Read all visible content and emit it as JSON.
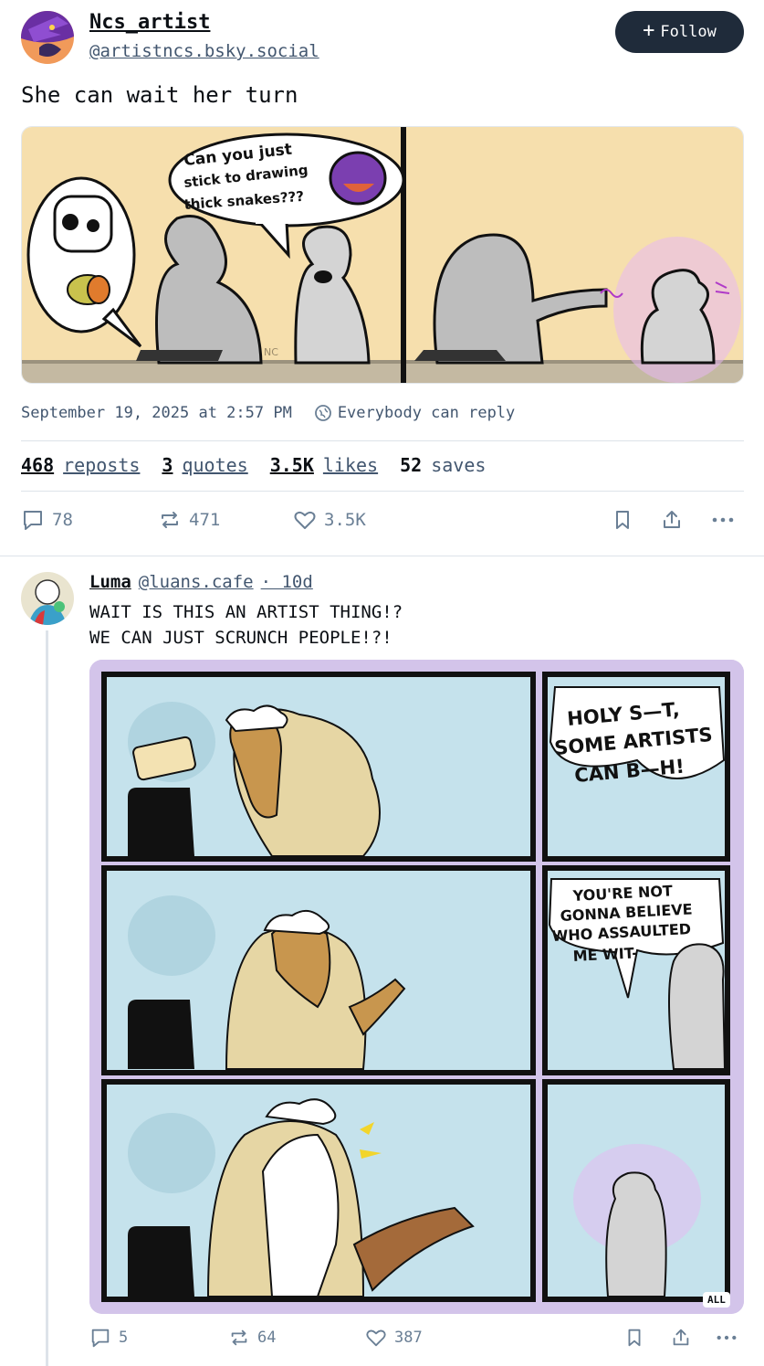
{
  "post": {
    "author_name": "Ncs_artist",
    "author_handle": "@artistncs.bsky.social",
    "follow_label": "Follow",
    "text": "She can wait her turn",
    "image": {
      "speech_line_1": "Can you just",
      "speech_line_2": "stick to drawing",
      "speech_line_3": "thick snakes???",
      "signature": "NC"
    },
    "timestamp": "September 19, 2025 at 2:57 PM",
    "reply_setting": "Everybody can reply",
    "stats": [
      {
        "count": "468",
        "label": "reposts"
      },
      {
        "count": "3",
        "label": "quotes"
      },
      {
        "count": "3.5K",
        "label": "likes"
      },
      {
        "count": "52",
        "label": "saves"
      }
    ],
    "actions": {
      "replies": "78",
      "reposts": "471",
      "likes": "3.5K"
    }
  },
  "reply": {
    "author_name": "Luma",
    "author_handle": "@luans.cafe",
    "time": "· 10d",
    "text_line_1": "WAIT IS THIS AN ARTIST THING!?",
    "text_line_2": "WE CAN JUST SCRUNCH PEOPLE!?!",
    "image": {
      "bubble1_line1": "HOLY S—T,",
      "bubble1_line2": "SOME ARTISTS",
      "bubble1_line3": "CAN B—H!",
      "bubble2_line1": "YOU'RE NOT",
      "bubble2_line2": "GONNA BELIEVE",
      "bubble2_line3": "WHO ASSAULTED",
      "bubble2_line4": "ME WIT-"
    },
    "badge": "ALL",
    "actions": {
      "replies": "5",
      "reposts": "64",
      "likes": "387"
    }
  },
  "colors": {
    "accent": "#1f2b3a",
    "muted": "#42566f",
    "icon": "#6a7f95",
    "comic_bg": "#f6dfad",
    "comic2_bg": "#c5e2ec",
    "comic2_frame": "#d3c4ea"
  }
}
